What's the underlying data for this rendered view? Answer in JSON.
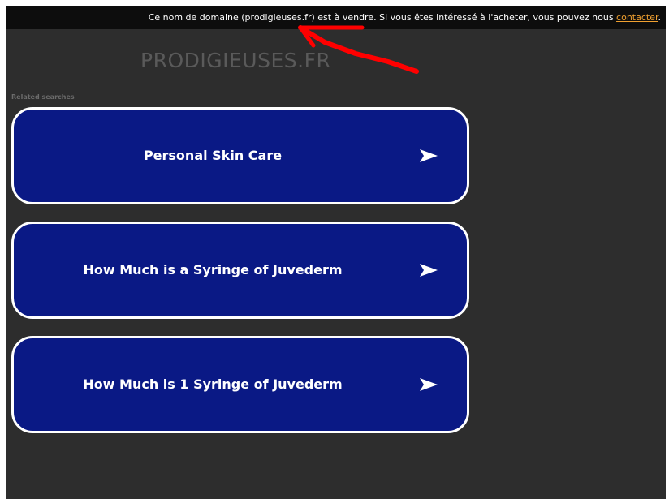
{
  "banner": {
    "text": "Ce nom de domaine (prodigieuses.fr) est à vendre. Si vous êtes intéressé à l'acheter, vous pouvez nous ",
    "link": "contacter",
    "end": "."
  },
  "site": {
    "title": "PRODIGIEUSES.FR"
  },
  "related": {
    "heading": "Related searches",
    "items": [
      {
        "label": "Personal Skin Care"
      },
      {
        "label": "How Much is a Syringe of Juvederm"
      },
      {
        "label": "How Much is 1 Syringe of Juvederm"
      }
    ]
  },
  "colors": {
    "background": "#2d2d2d",
    "banner": "#0d0d0d",
    "card": "#0a1985",
    "link": "#f0a030",
    "annotation": "#ff0000"
  }
}
